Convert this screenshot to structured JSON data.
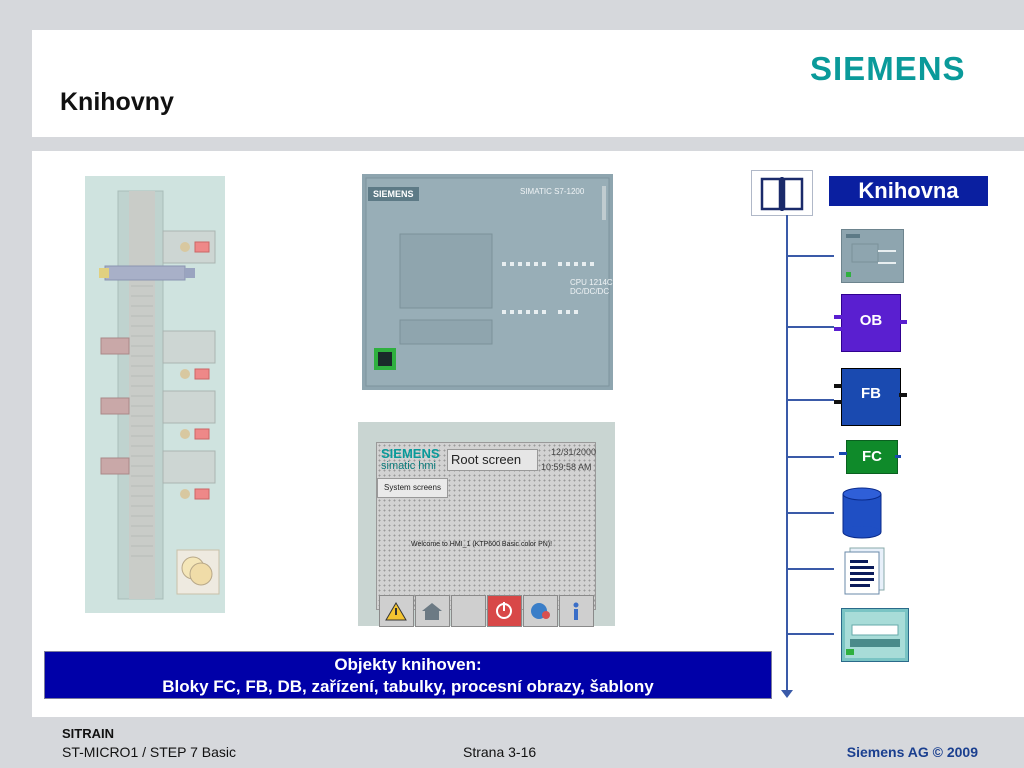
{
  "slide": {
    "title": "Knihovny",
    "logo": "SIEMENS",
    "library_label": "Knihovna",
    "banner_line1": "Objekty knihoven:",
    "banner_line2": "Bloky FC, FB, DB, zařízení, tabulky, procesní obrazy, šablony"
  },
  "plc": {
    "brand": "SIEMENS",
    "model": "SIMATIC S7-1200",
    "cpu_line1": "CPU 1214C",
    "cpu_line2": "DC/DC/DC"
  },
  "hmi": {
    "brand": "SIEMENS",
    "product": "simatic hmi",
    "root_screen": "Root screen",
    "date": "12/31/2000",
    "time": "10:59:58 AM",
    "system_screens": "System screens",
    "welcome": "Welcome to HMI_1 (KTP600 Basic color PN)!"
  },
  "library_items": [
    "OB",
    "FB",
    "FC"
  ],
  "footer": {
    "brand": "SITRAIN",
    "course": "ST-MICRO1 / STEP 7 Basic",
    "page": "Strana 3-16",
    "copyright": "Siemens AG © 2009"
  },
  "colors": {
    "logo": "#0a9a9a",
    "banner": "#0000a8",
    "ob": "#5a1fd0",
    "fb": "#1a4ab0",
    "fc": "#0f8a2a",
    "db": "#1f4fc4",
    "footer_copy": "#1a3f8f"
  }
}
